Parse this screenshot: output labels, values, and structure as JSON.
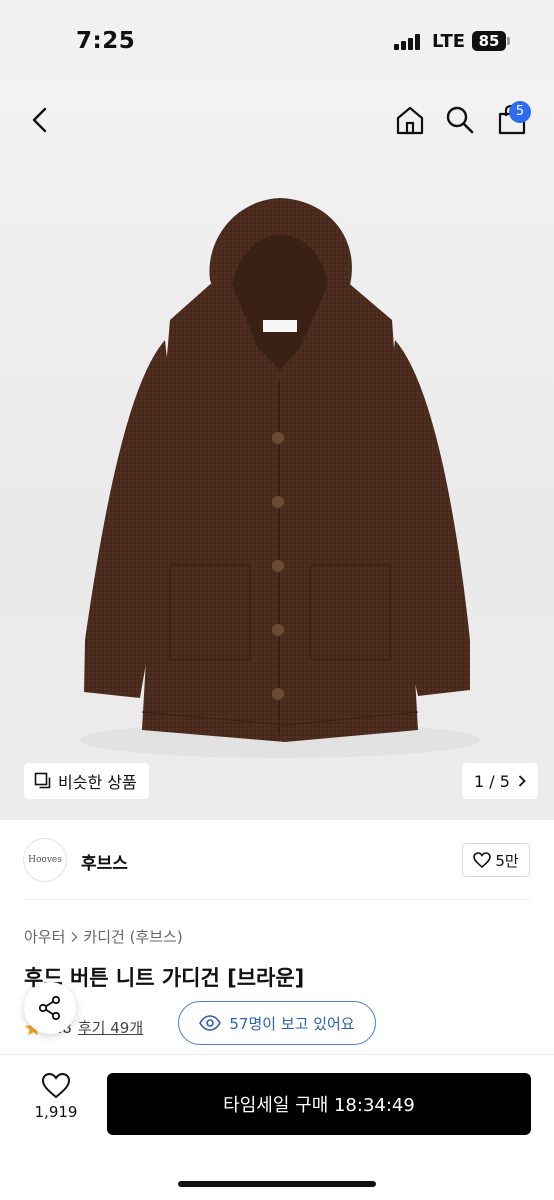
{
  "status_bar": {
    "time": "7:25",
    "network": "LTE",
    "battery": "85"
  },
  "nav": {
    "back_icon": "chevron-left-icon",
    "home_icon": "home-icon",
    "search_icon": "search-icon",
    "cart_icon": "cart-icon",
    "cart_count": "5"
  },
  "gallery": {
    "similar_label": "비슷한 상품",
    "pager": "1 / 5",
    "garment_color": "#4a2a1c"
  },
  "brand": {
    "logo_text": "Hooves",
    "name": "후브스",
    "likes": "5만"
  },
  "breadcrumb": {
    "category": "아우터",
    "subcategory": "카디건 (후브스)"
  },
  "product": {
    "title": "후드 버튼 니트 가디건 [브라운]",
    "rating": "4.8",
    "reviews": "후기 49개",
    "viewers": "57명이 보고 있어요"
  },
  "bottom_bar": {
    "wish_count": "1,919",
    "buy_label": "타임세일 구매 18:34:49"
  },
  "colors": {
    "accent_blue": "#2d6bf0",
    "star": "#f5a623",
    "buy_button": "#000000"
  }
}
